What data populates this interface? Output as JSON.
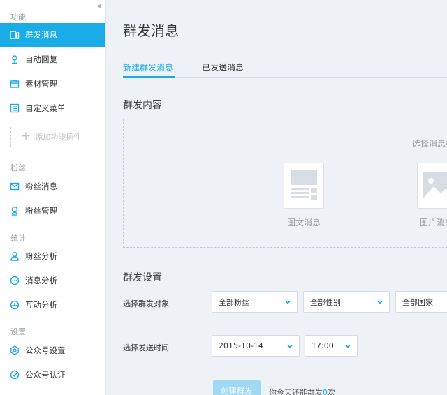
{
  "sidebar": {
    "sections": [
      "功能",
      "粉丝",
      "统计",
      "设置"
    ],
    "items": [
      {
        "label": "群发消息",
        "icon": "broadcast-icon",
        "active": true
      },
      {
        "label": "自动回复",
        "icon": "auto-reply-icon"
      },
      {
        "label": "素材管理",
        "icon": "folder-icon"
      },
      {
        "label": "自定义菜单",
        "icon": "menu-icon"
      },
      {
        "label": "粉丝消息",
        "icon": "mail-icon"
      },
      {
        "label": "粉丝管理",
        "icon": "fans-icon"
      },
      {
        "label": "粉丝分析",
        "icon": "user-icon"
      },
      {
        "label": "消息分析",
        "icon": "chat-bubble-icon"
      },
      {
        "label": "互动分析",
        "icon": "interaction-icon"
      },
      {
        "label": "公众号设置",
        "icon": "gear-icon"
      },
      {
        "label": "公众号认证",
        "icon": "verified-icon"
      }
    ],
    "add_plugin": "添加功能插件"
  },
  "main": {
    "title": "群发消息",
    "tabs": [
      "新建群发消息",
      "已发送消息"
    ],
    "content_heading": "群发内容",
    "choose_hint": "选择消息类型",
    "types": [
      "图文消息",
      "图片消息"
    ],
    "settings_heading": "群发设置",
    "target_label": "选择群发对象",
    "target_selects": [
      "全部粉丝",
      "全部性别",
      "全部国家"
    ],
    "time_label": "选择发送时间",
    "date_value": "2015-10-14",
    "time_value": "17:00",
    "create_button": "创建群发",
    "quota_prefix": "你今天还能群发",
    "quota_count": "0",
    "quota_suffix": "次"
  },
  "colors": {
    "accent": "#1aace8",
    "background": "#eef1f6",
    "button_disabled": "#9fd9f4"
  }
}
